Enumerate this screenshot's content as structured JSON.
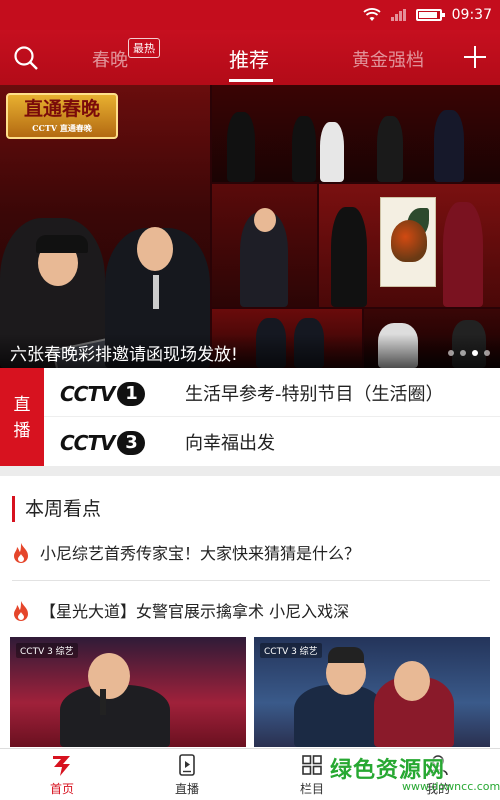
{
  "status_bar": {
    "time": "09:37",
    "battery_percent": 90
  },
  "top_nav": {
    "tabs": [
      {
        "label": "春晚",
        "badge": "最热"
      },
      {
        "label": "推荐"
      },
      {
        "label": "黄金强档"
      }
    ],
    "active_tab": "推荐"
  },
  "banner": {
    "logo_text": "直通春晚",
    "logo_sub": "CCTV 直通春晚",
    "caption": "六张春晚彩排邀请函现场发放!",
    "slide_count": 4,
    "active_slide": 2
  },
  "live": {
    "tag": "直\n播",
    "tag_line1": "直",
    "tag_line2": "播",
    "channels": [
      {
        "logo_word": "CCTV",
        "logo_num": "1",
        "title": "生活早参考-特别节目（生活圈）"
      },
      {
        "logo_word": "CCTV",
        "logo_num": "3",
        "title": "向幸福出发"
      }
    ]
  },
  "weekly": {
    "title": "本周看点",
    "items": [
      {
        "text": "小尼综艺首秀传家宝！大家快来猜猜是什么？"
      },
      {
        "text": "【星光大道】女警官展示擒拿术 小尼入戏深"
      }
    ],
    "thumbs": [
      {
        "logo": "CCTV 3 综艺"
      },
      {
        "logo": "CCTV 3 综艺"
      }
    ]
  },
  "bottom_nav": {
    "items": [
      {
        "label": "首页",
        "icon": "home-3-icon"
      },
      {
        "label": "直播",
        "icon": "live-icon"
      },
      {
        "label": "栏目",
        "icon": "grid-icon"
      },
      {
        "label": "我的",
        "icon": "user-icon"
      }
    ],
    "active": "首页"
  },
  "watermark": {
    "text": "绿色资源网",
    "url": "www.downcc.com"
  },
  "colors": {
    "brand_red": "#c40d1d",
    "live_red": "#d7121f",
    "watermark_green": "#27a832"
  }
}
